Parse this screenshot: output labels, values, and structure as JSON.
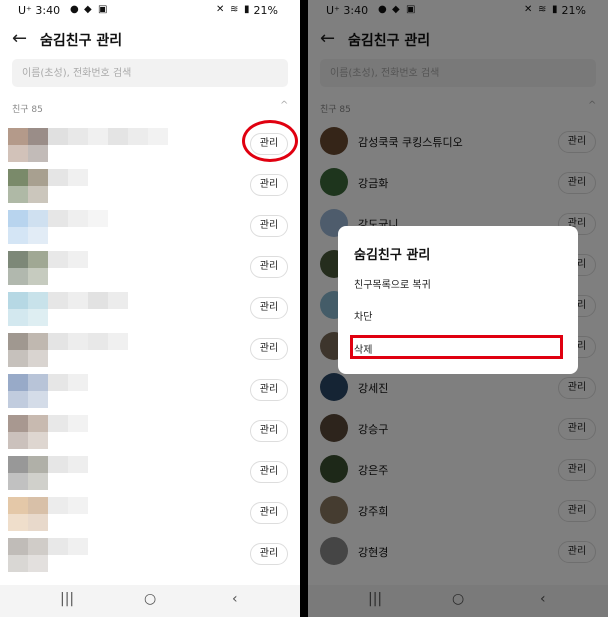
{
  "status": {
    "time": "3:40",
    "carrier": "U⁺",
    "battery": "21%"
  },
  "header": {
    "back_icon": "arrow-left-icon",
    "title": "숨김친구 관리"
  },
  "search": {
    "placeholder": "이름(초성), 전화번호 검색"
  },
  "section": {
    "label": "친구 85"
  },
  "manage_label": "관리",
  "blurred_rows": [
    {
      "c": [
        "#b49a8a",
        "#9a8d88",
        "#e0e0e0",
        "#e8e8e8",
        "#f0f0f0",
        "#e4e4e4",
        "#ececec",
        "#f2f2f2"
      ]
    },
    {
      "c": [
        "#7a8a6a",
        "#a8a090",
        "#e5e5e5",
        "#f0f0f0"
      ]
    },
    {
      "c": [
        "#b8d4ee",
        "#cfe0f0",
        "#e6e6e6",
        "#efefef",
        "#f5f5f5"
      ]
    },
    {
      "c": [
        "#7d8878",
        "#a0a894",
        "#e8e8e8",
        "#f0f0f0"
      ]
    },
    {
      "c": [
        "#b6d8e4",
        "#c8e2ea",
        "#e6e6e6",
        "#eeeeee",
        "#e2e2e2",
        "#ececec"
      ]
    },
    {
      "c": [
        "#a09890",
        "#c0b8b0",
        "#e4e4e4",
        "#ededed",
        "#e8e8e8",
        "#f0f0f0"
      ]
    },
    {
      "c": [
        "#98aac8",
        "#b8c4d8",
        "#e6e6e6",
        "#f0f0f0"
      ]
    },
    {
      "c": [
        "#a89890",
        "#c8bab0",
        "#e8e8e8",
        "#f2f2f2"
      ]
    },
    {
      "c": [
        "#989898",
        "#b0b0a8",
        "#e6e6e6",
        "#eeeeee"
      ]
    },
    {
      "c": [
        "#e4c8a8",
        "#d8c0a8",
        "#ececec",
        "#f2f2f2"
      ]
    },
    {
      "c": [
        "#c0bcb8",
        "#d0ccc8",
        "#e8e8e8",
        "#f0f0f0"
      ]
    }
  ],
  "friends": [
    {
      "name": "감성쿡쿡 쿠킹스튜디오",
      "avatar": "#6b4a30"
    },
    {
      "name": "강금화",
      "avatar": "#3d6b3a"
    },
    {
      "name": "강도균니",
      "avatar": "#9cb8d8"
    },
    {
      "name": "",
      "avatar": "#4a5a3a"
    },
    {
      "name": "",
      "avatar": "#88b8d0"
    },
    {
      "name": "",
      "avatar": "#7a6a58"
    },
    {
      "name": "강세진",
      "avatar": "#2a4868"
    },
    {
      "name": "강승구",
      "avatar": "#5a4838"
    },
    {
      "name": "강은주",
      "avatar": "#3a5030"
    },
    {
      "name": "강주희",
      "avatar": "#8a7860"
    },
    {
      "name": "강현경",
      "avatar": "#8a8a8a"
    }
  ],
  "dialog": {
    "title": "숨김친구 관리",
    "options": [
      "친구목록으로 복귀",
      "차단",
      "삭제"
    ]
  },
  "nav": {
    "recents": "|||",
    "home": "○",
    "back": "‹"
  },
  "colors": {
    "highlight": "#e00010"
  }
}
